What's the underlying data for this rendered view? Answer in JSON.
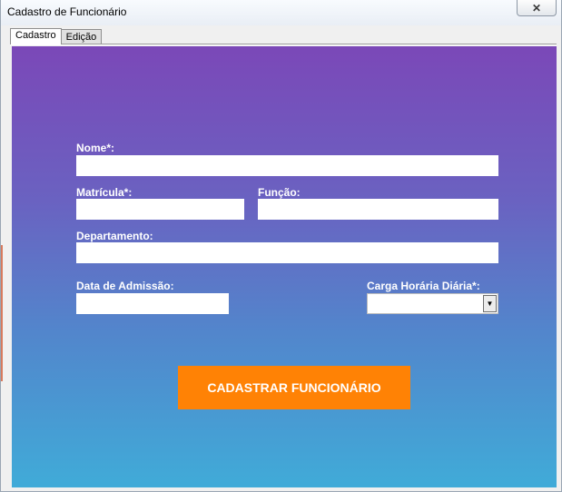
{
  "window": {
    "title": "Cadastro de Funcionário",
    "close_glyph": "✕"
  },
  "tabs": [
    {
      "label": "Cadastro",
      "active": true
    },
    {
      "label": "Edição",
      "active": false
    }
  ],
  "form": {
    "nome_label": "Nome*:",
    "nome_value": "",
    "matricula_label": "Matrícula*:",
    "matricula_value": "",
    "funcao_label": "Função:",
    "funcao_value": "",
    "departamento_label": "Departamento:",
    "departamento_value": "",
    "data_admissao_label": "Data de Admissão:",
    "data_admissao_value": "",
    "carga_horaria_label": "Carga Horária Diária*:",
    "carga_horaria_value": "",
    "carga_horaria_dropdown_icon": "▼",
    "submit_label": "CADASTRAR FUNCIONÁRIO"
  },
  "colors": {
    "gradient_top": "#7b48b8",
    "gradient_bottom": "#40abd8",
    "submit_button": "#ff8205",
    "label_text": "#ffffff"
  }
}
